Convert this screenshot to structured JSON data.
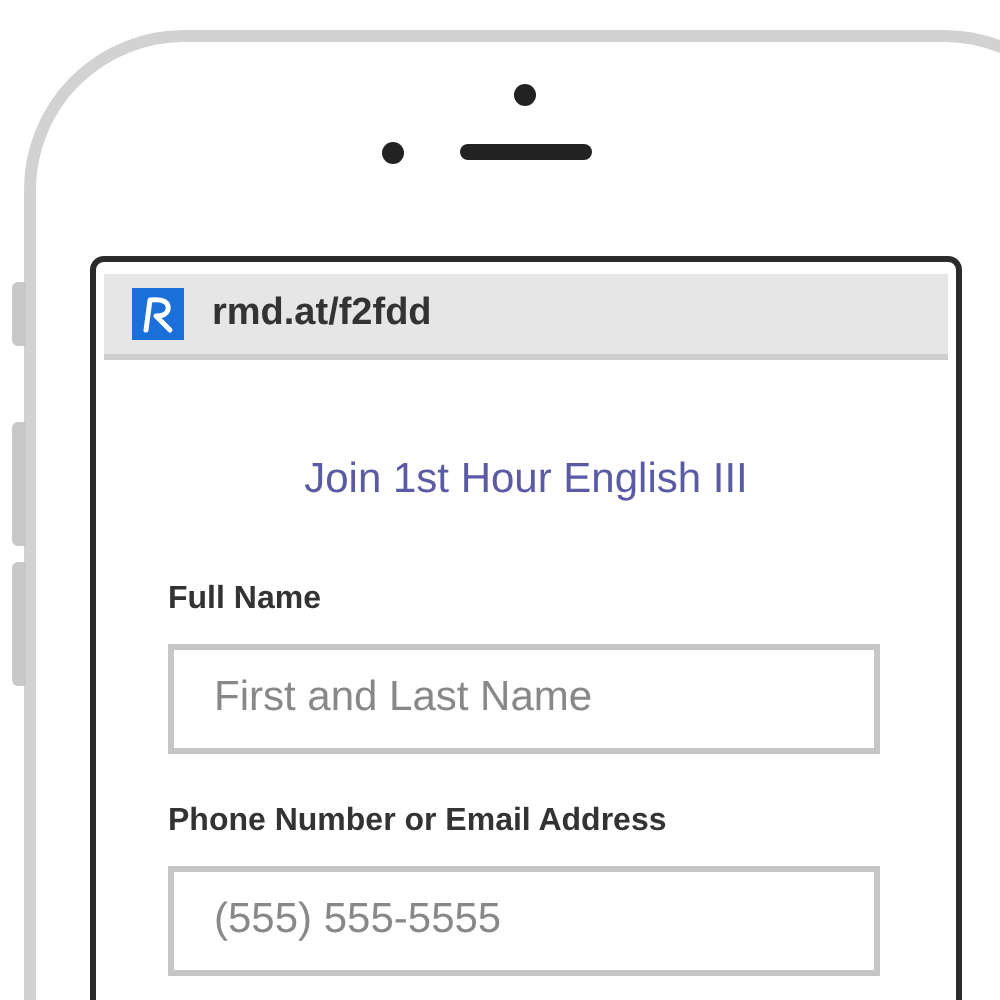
{
  "address_bar": {
    "url": "rmd.at/f2fdd"
  },
  "form": {
    "title": "Join 1st Hour English III",
    "fields": [
      {
        "label": "Full Name",
        "placeholder": "First and Last Name"
      },
      {
        "label": "Phone Number or Email Address",
        "placeholder": "(555) 555-5555"
      }
    ]
  }
}
